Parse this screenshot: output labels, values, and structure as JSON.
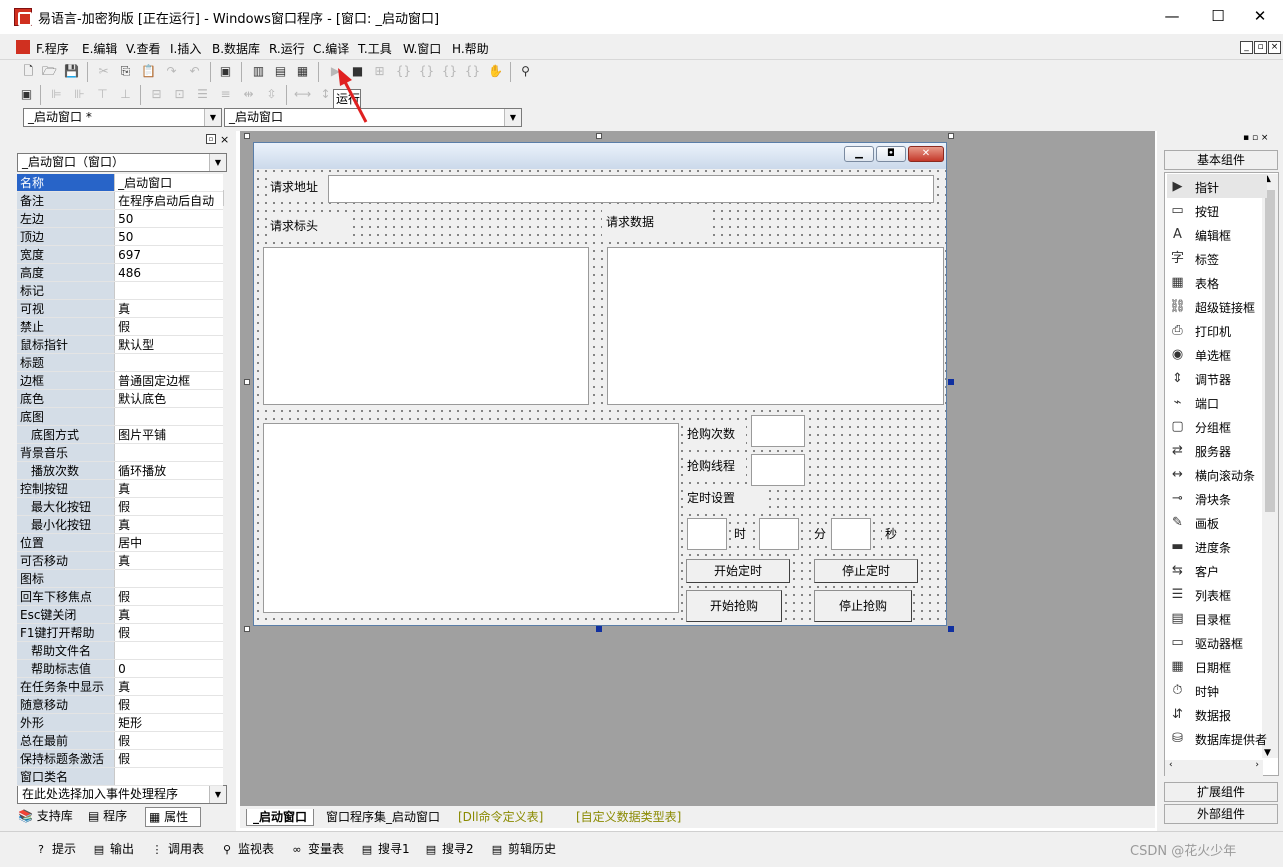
{
  "window": {
    "title": "易语言-加密狗版 [正在运行] - Windows窗口程序 - [窗口: _启动窗口]",
    "min": "—",
    "max": "☐",
    "close": "✕"
  },
  "menu": [
    "F.程序",
    "E.编辑",
    "V.查看",
    "I.插入",
    "B.数据库",
    "R.运行",
    "C.编译",
    "T.工具",
    "W.窗口",
    "H.帮助"
  ],
  "mdi": {
    "min": "_",
    "restore": "▫",
    "close": "×"
  },
  "tooltip": "运行",
  "combos": {
    "left": "_启动窗口 *",
    "right": "_启动窗口"
  },
  "left_panel": {
    "window_combo": "_启动窗口（窗口）",
    "event_combo": "在此处选择加入事件处理程序",
    "tabs": [
      "支持库",
      "程序",
      "属性"
    ],
    "properties": [
      {
        "k": "名称",
        "v": "_启动窗口",
        "sel": true
      },
      {
        "k": "备注",
        "v": "在程序启动后自动"
      },
      {
        "k": "左边",
        "v": "50"
      },
      {
        "k": "顶边",
        "v": "50"
      },
      {
        "k": "宽度",
        "v": "697"
      },
      {
        "k": "高度",
        "v": "486"
      },
      {
        "k": "标记",
        "v": ""
      },
      {
        "k": "可视",
        "v": "真"
      },
      {
        "k": "禁止",
        "v": "假"
      },
      {
        "k": "鼠标指针",
        "v": "默认型"
      },
      {
        "k": "标题",
        "v": ""
      },
      {
        "k": "边框",
        "v": "普通固定边框"
      },
      {
        "k": "底色",
        "v": "默认底色"
      },
      {
        "k": "底图",
        "v": ""
      },
      {
        "k": "底图方式",
        "v": "图片平铺",
        "sub": true
      },
      {
        "k": "背景音乐",
        "v": ""
      },
      {
        "k": "播放次数",
        "v": "循环播放",
        "sub": true
      },
      {
        "k": "控制按钮",
        "v": "真"
      },
      {
        "k": "最大化按钮",
        "v": "假",
        "sub": true
      },
      {
        "k": "最小化按钮",
        "v": "真",
        "sub": true
      },
      {
        "k": "位置",
        "v": "居中"
      },
      {
        "k": "可否移动",
        "v": "真"
      },
      {
        "k": "图标",
        "v": ""
      },
      {
        "k": "回车下移焦点",
        "v": "假"
      },
      {
        "k": "Esc键关闭",
        "v": "真"
      },
      {
        "k": "F1键打开帮助",
        "v": "假"
      },
      {
        "k": "帮助文件名",
        "v": "",
        "sub": true
      },
      {
        "k": "帮助标志值",
        "v": "0",
        "sub": true
      },
      {
        "k": "在任务条中显示",
        "v": "真"
      },
      {
        "k": "随意移动",
        "v": "假"
      },
      {
        "k": "外形",
        "v": "矩形"
      },
      {
        "k": "总在最前",
        "v": "假"
      },
      {
        "k": "保持标题条激活",
        "v": "假"
      },
      {
        "k": "窗口类名",
        "v": ""
      }
    ]
  },
  "form": {
    "url_label": "请求地址",
    "headers_label": "请求标头",
    "data_label": "请求数据",
    "count_label": "抢购次数",
    "thread_label": "抢购线程",
    "timer_label": "定时设置",
    "hour": "时",
    "minute": "分",
    "second": "秒",
    "btn_start_timer": "开始定时",
    "btn_stop_timer": "停止定时",
    "btn_start_buy": "开始抢购",
    "btn_stop_buy": "停止抢购"
  },
  "bottom_tabs": [
    "_启动窗口",
    "窗口程序集_启动窗口",
    "[Dll命令定义表]",
    "[自定义数据类型表]"
  ],
  "right_panel": {
    "header": "基本组件",
    "items": [
      {
        "icon": "▶",
        "label": "指针"
      },
      {
        "icon": "▭",
        "label": "按钮"
      },
      {
        "icon": "A",
        "label": "编辑框"
      },
      {
        "icon": "字",
        "label": "标签"
      },
      {
        "icon": "▦",
        "label": "表格"
      },
      {
        "icon": "⛓",
        "label": "超级链接框"
      },
      {
        "icon": "⎙",
        "label": "打印机"
      },
      {
        "icon": "◉",
        "label": "单选框"
      },
      {
        "icon": "⇕",
        "label": "调节器"
      },
      {
        "icon": "⌁",
        "label": "端口"
      },
      {
        "icon": "▢",
        "label": "分组框"
      },
      {
        "icon": "⇄",
        "label": "服务器"
      },
      {
        "icon": "↔",
        "label": "横向滚动条"
      },
      {
        "icon": "⊸",
        "label": "滑块条"
      },
      {
        "icon": "✎",
        "label": "画板"
      },
      {
        "icon": "▬",
        "label": "进度条"
      },
      {
        "icon": "⇆",
        "label": "客户"
      },
      {
        "icon": "☰",
        "label": "列表框"
      },
      {
        "icon": "▤",
        "label": "目录框"
      },
      {
        "icon": "▭",
        "label": "驱动器框"
      },
      {
        "icon": "▦",
        "label": "日期框"
      },
      {
        "icon": "⏱",
        "label": "时钟"
      },
      {
        "icon": "⇵",
        "label": "数据报"
      },
      {
        "icon": "⛁",
        "label": "数据库提供者"
      }
    ],
    "ext": "扩展组件",
    "outer": "外部组件"
  },
  "status_tabs": [
    {
      "icon": "?",
      "label": "提示"
    },
    {
      "icon": "▤",
      "label": "输出"
    },
    {
      "icon": "⋮",
      "label": "调用表"
    },
    {
      "icon": "🔍",
      "label": "监视表"
    },
    {
      "icon": "∞",
      "label": "变量表"
    },
    {
      "icon": "▤",
      "label": "搜寻1"
    },
    {
      "icon": "▤",
      "label": "搜寻2"
    },
    {
      "icon": "▤",
      "label": "剪辑历史"
    }
  ],
  "watermark": "CSDN @花火少年"
}
